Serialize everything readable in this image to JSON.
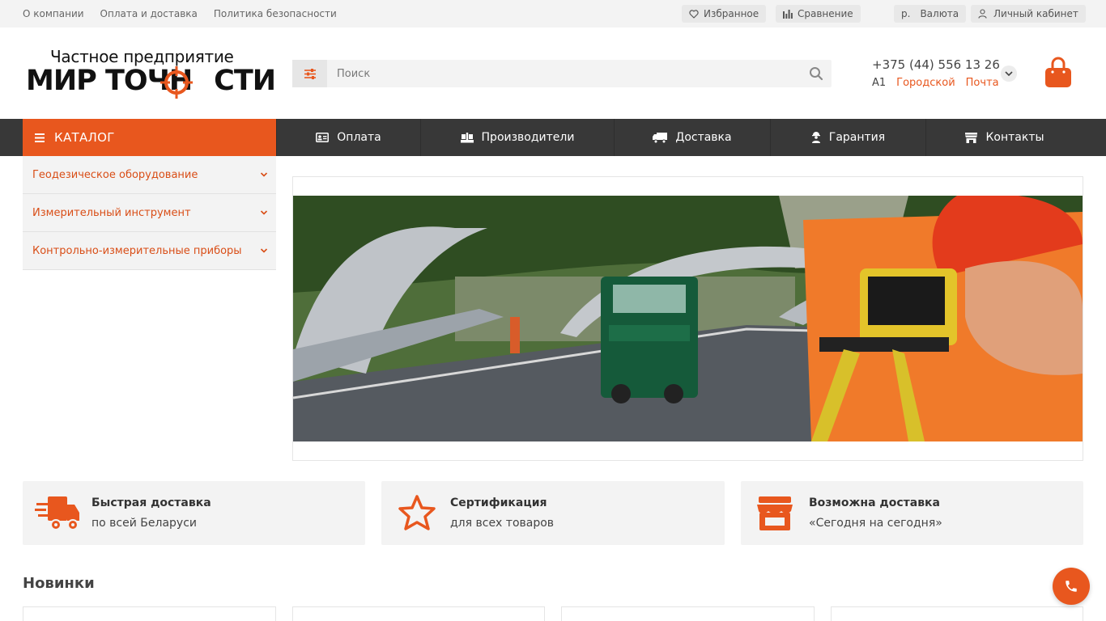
{
  "topbar": {
    "links": [
      "О компании",
      "Оплата и доставка",
      "Политика безопасности"
    ],
    "favorites": "Избранное",
    "compare": "Сравнение",
    "currency_symbol": "р.",
    "currency": "Валюта",
    "account": "Личный кабинет"
  },
  "logo": {
    "line1": "Частное предприятие",
    "line2_a": "МИР ТОЧН",
    "line2_b": "СТИ"
  },
  "search": {
    "placeholder": "Поиск"
  },
  "contact": {
    "phone": "+375 (44) 556 13 26",
    "operators": [
      "А1",
      "Городской",
      "Почта"
    ]
  },
  "nav": {
    "catalog": "КАТАЛОГ",
    "items": [
      "Оплата",
      "Производители",
      "Доставка",
      "Гарантия",
      "Контакты"
    ]
  },
  "sidebar": {
    "items": [
      "Геодезическое оборудование",
      "Измерительный инструмент",
      "Контрольно-измерительные приборы"
    ]
  },
  "features": [
    {
      "title": "Быстрая доставка",
      "subtitle": "по всей Беларуси",
      "icon": "truck-icon"
    },
    {
      "title": "Сертификация",
      "subtitle": "для всех товаров",
      "icon": "star-icon"
    },
    {
      "title": "Возможна доставка",
      "subtitle": "«Сегодня на сегодня»",
      "icon": "store-icon"
    }
  ],
  "sections": {
    "new_title": "Новинки"
  },
  "colors": {
    "accent": "#e8571e",
    "nav_bg": "#383838",
    "topbar_bg": "#f3f3f3"
  }
}
